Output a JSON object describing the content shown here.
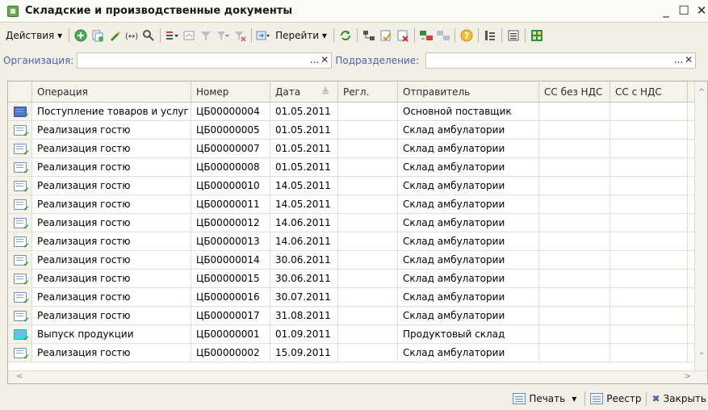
{
  "window": {
    "title": "Складские и производственные документы",
    "minimize": "_",
    "maximize": "☐",
    "close": "✕"
  },
  "toolbar": {
    "actions_label": "Действия",
    "dropdown_arrow": "▾",
    "goto_label": "Перейти"
  },
  "filter": {
    "org_label": "Организация:",
    "org_value": "",
    "dept_label": "Подразделение:",
    "dept_value": "",
    "dots": "...",
    "clear": "✕"
  },
  "columns": [
    "Операция",
    "Номер",
    "Дата",
    "Регл.",
    "Отправитель",
    "СС без НДС",
    "СС с НДС"
  ],
  "sort_indicator": "≜",
  "rows": [
    {
      "op": "Поступление товаров и услуг",
      "num": "ЦБ00000004",
      "date": "01.05.2011",
      "regl": "",
      "sender": "Основной поставщик",
      "ss": "",
      "ssnds": ""
    },
    {
      "op": "Реализация гостю",
      "num": "ЦБ00000005",
      "date": "01.05.2011",
      "regl": "",
      "sender": "Склад амбулатории",
      "ss": "",
      "ssnds": ""
    },
    {
      "op": "Реализация гостю",
      "num": "ЦБ00000007",
      "date": "01.05.2011",
      "regl": "",
      "sender": "Склад амбулатории",
      "ss": "",
      "ssnds": ""
    },
    {
      "op": "Реализация гостю",
      "num": "ЦБ00000008",
      "date": "01.05.2011",
      "regl": "",
      "sender": "Склад амбулатории",
      "ss": "",
      "ssnds": ""
    },
    {
      "op": "Реализация гостю",
      "num": "ЦБ00000010",
      "date": "14.05.2011",
      "regl": "",
      "sender": "Склад амбулатории",
      "ss": "",
      "ssnds": ""
    },
    {
      "op": "Реализация гостю",
      "num": "ЦБ00000011",
      "date": "14.05.2011",
      "regl": "",
      "sender": "Склад амбулатории",
      "ss": "",
      "ssnds": ""
    },
    {
      "op": "Реализация гостю",
      "num": "ЦБ00000012",
      "date": "14.06.2011",
      "regl": "",
      "sender": "Склад амбулатории",
      "ss": "",
      "ssnds": ""
    },
    {
      "op": "Реализация гостю",
      "num": "ЦБ00000013",
      "date": "14.06.2011",
      "regl": "",
      "sender": "Склад амбулатории",
      "ss": "",
      "ssnds": ""
    },
    {
      "op": "Реализация гостю",
      "num": "ЦБ00000014",
      "date": "30.06.2011",
      "regl": "",
      "sender": "Склад амбулатории",
      "ss": "",
      "ssnds": ""
    },
    {
      "op": "Реализация гостю",
      "num": "ЦБ00000015",
      "date": "30.06.2011",
      "regl": "",
      "sender": "Склад амбулатории",
      "ss": "",
      "ssnds": ""
    },
    {
      "op": "Реализация гостю",
      "num": "ЦБ00000016",
      "date": "30.07.2011",
      "regl": "",
      "sender": "Склад амбулатории",
      "ss": "",
      "ssnds": ""
    },
    {
      "op": "Реализация гостю",
      "num": "ЦБ00000017",
      "date": "31.08.2011",
      "regl": "",
      "sender": "Склад амбулатории",
      "ss": "",
      "ssnds": ""
    },
    {
      "op": "Выпуск продукции",
      "num": "ЦБ00000001",
      "date": "01.09.2011",
      "regl": "",
      "sender": "Продуктовый склад",
      "ss": "",
      "ssnds": ""
    },
    {
      "op": "Реализация гостю",
      "num": "ЦБ00000002",
      "date": "15.09.2011",
      "regl": "",
      "sender": "Склад амбулатории",
      "ss": "",
      "ssnds": ""
    }
  ],
  "statusbar": {
    "print_label": "Печать",
    "registry_label": "Реестр",
    "close_label": "Закрыть",
    "dropdown_arrow": "▾",
    "close_icon": "✖"
  }
}
